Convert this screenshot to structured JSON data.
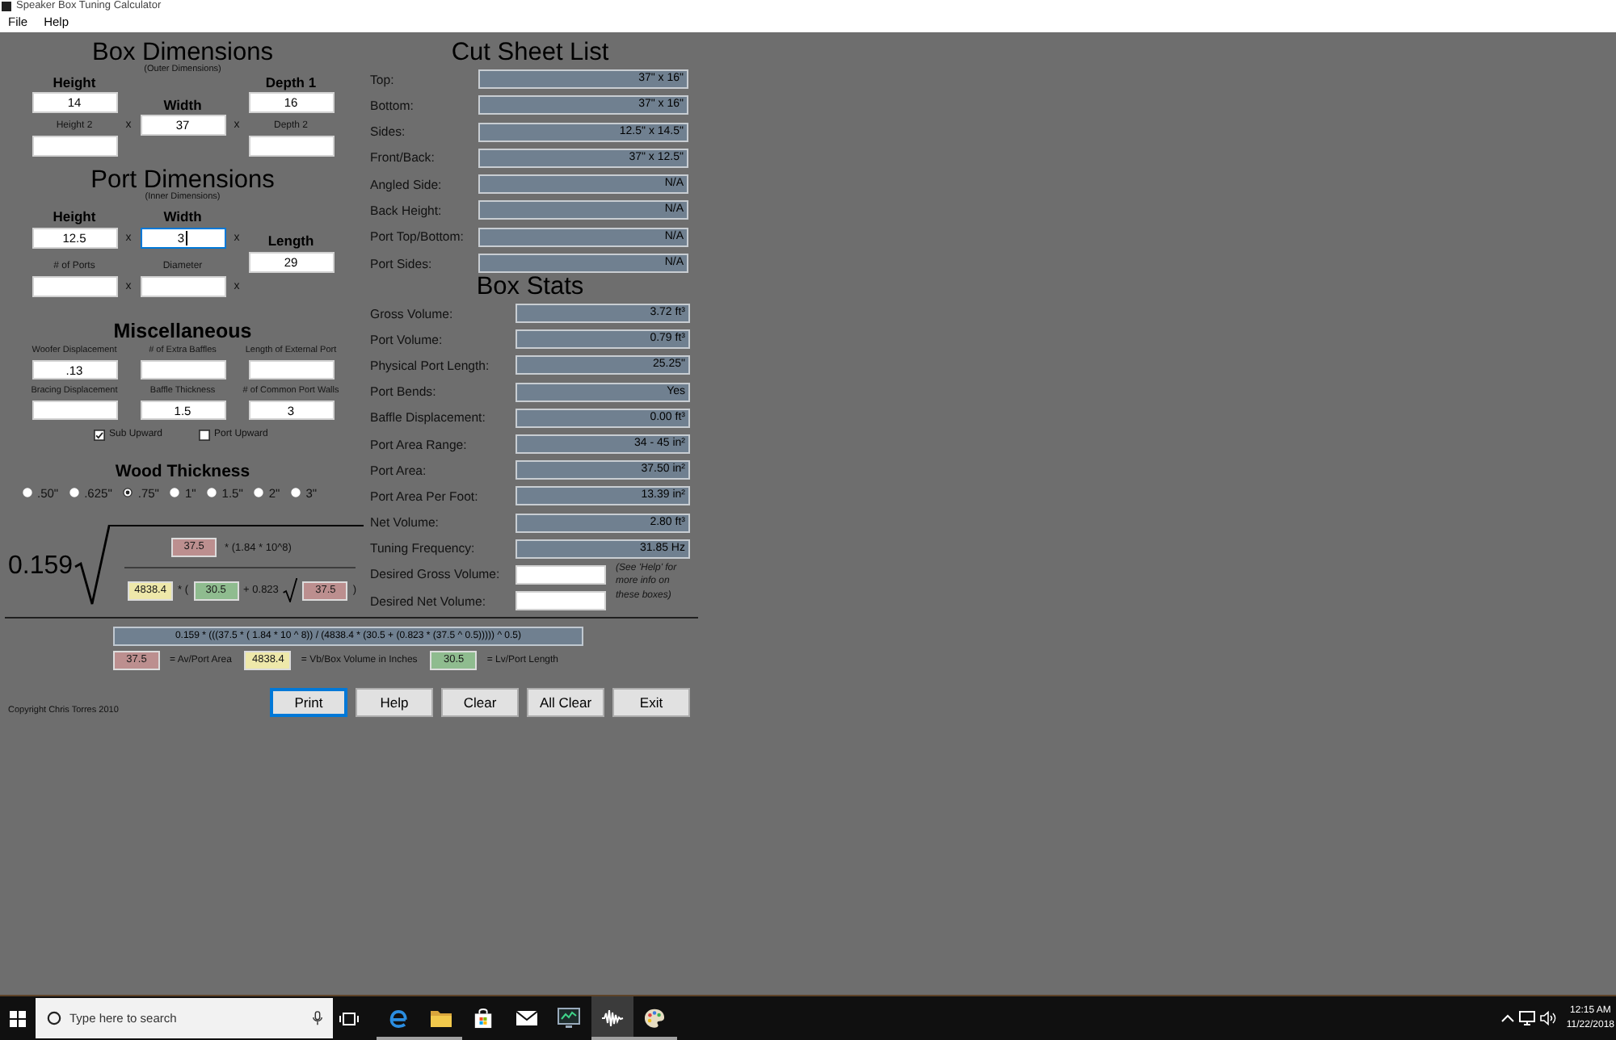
{
  "window": {
    "title": "Speaker Box Tuning Calculator"
  },
  "menu": [
    "File",
    "Help"
  ],
  "box_dimensions": {
    "title": "Box Dimensions",
    "subtitle": "(Outer Dimensions)",
    "columns": [
      {
        "fields": [
          {
            "label": "Height",
            "kind": "main",
            "value": "14",
            "focused": false
          },
          {
            "label": "Height 2",
            "kind": "minor",
            "focused": false
          }
        ]
      },
      {
        "fields": [
          {
            "label": "Width",
            "kind": "main",
            "value": "37",
            "focused": false
          }
        ]
      },
      {
        "fields": [
          {
            "label": "Depth 1",
            "kind": "main",
            "value": "16",
            "focused": false
          },
          {
            "label": "Depth 2",
            "kind": "minor",
            "focused": false
          }
        ]
      }
    ],
    "separators": [
      [
        "x"
      ],
      [
        "x"
      ]
    ]
  },
  "port_dimensions": {
    "title": "Port Dimensions",
    "subtitle": "(Inner Dimensions)",
    "columns": [
      {
        "fields": [
          {
            "label": "Height",
            "kind": "main",
            "value": "12.5",
            "focused": false
          },
          {
            "label": "# of Ports",
            "kind": "minor",
            "focused": false
          }
        ]
      },
      {
        "fields": [
          {
            "label": "Width",
            "kind": "main",
            "value": "3",
            "focused": true
          },
          {
            "label": "Diameter",
            "kind": "minor",
            "focused": false
          }
        ]
      },
      {
        "fields": [
          {
            "label": "Length",
            "kind": "main",
            "value": "29",
            "focused": false
          }
        ]
      }
    ],
    "separators": [
      [
        "x",
        "x"
      ],
      [
        "x",
        "x"
      ]
    ]
  },
  "miscellaneous": {
    "title": "Miscellaneous",
    "columns": [
      {
        "fields": [
          {
            "label": "Woofer Displacement",
            "kind": "minor",
            "value": ".13",
            "focused": false
          },
          {
            "label": "Bracing Displacement",
            "kind": "minor",
            "focused": false
          }
        ]
      },
      {
        "fields": [
          {
            "label": "# of Extra Baffles",
            "kind": "minor",
            "focused": false
          },
          {
            "label": "Baffle Thickness",
            "kind": "minor",
            "value": "1.5",
            "focused": false
          }
        ]
      },
      {
        "fields": [
          {
            "label": "Length of External Port",
            "kind": "minor",
            "focused": false
          },
          {
            "label": "# of Common Port Walls",
            "kind": "minor",
            "value": "3",
            "focused": false
          }
        ]
      }
    ],
    "checkboxes": [
      {
        "label": "Sub Upward",
        "checked": true
      },
      {
        "label": "Port Upward",
        "checked": false
      }
    ]
  },
  "wood_thickness": {
    "title": "Wood Thickness",
    "options": [
      {
        "label": ".50\"",
        "selected": false
      },
      {
        "label": ".625\"",
        "selected": false
      },
      {
        "label": ".75\"",
        "selected": true
      },
      {
        "label": "1\"",
        "selected": false
      },
      {
        "label": "1.5\"",
        "selected": false
      },
      {
        "label": "2\"",
        "selected": false
      },
      {
        "label": "3\"",
        "selected": false
      }
    ]
  },
  "formula": {
    "coefficient": "0.159",
    "numerator": [
      {
        "kind": "value",
        "value": "37.5",
        "color": "#bc8f8f"
      },
      {
        "kind": "text",
        "text": "* (1.84 * 10^8)"
      }
    ],
    "denominator": [
      {
        "kind": "value",
        "value": "4838.4",
        "color": "#eee8aa"
      },
      {
        "kind": "text",
        "text": "* ("
      },
      {
        "kind": "value",
        "value": "30.5",
        "color": "#8fbc8f"
      },
      {
        "kind": "text",
        "text": "+ 0.823"
      },
      {
        "kind": "root"
      },
      {
        "kind": "value",
        "value": "37.5",
        "color": "#bc8f8f"
      },
      {
        "kind": "text",
        "text": ")"
      }
    ]
  },
  "cut_sheet": {
    "title": "Cut Sheet List",
    "rows": [
      {
        "label": "Top:",
        "value": "37\" x 16\""
      },
      {
        "label": "Bottom:",
        "value": "37\" x 16\""
      },
      {
        "label": "Sides:",
        "value": "12.5\" x 14.5\""
      },
      {
        "label": "Front/Back:",
        "value": "37\" x 12.5\""
      },
      {
        "label": "Angled Side:",
        "value": "N/A"
      },
      {
        "label": "Back Height:",
        "value": "N/A"
      },
      {
        "label": "Port Top/Bottom:",
        "value": "N/A"
      },
      {
        "label": "Port Sides:",
        "value": "N/A"
      }
    ]
  },
  "box_stats": {
    "title": "Box Stats",
    "rows": [
      {
        "label": "Gross Volume:",
        "value": "3.72 ft³"
      },
      {
        "label": "Port Volume:",
        "value": "0.79 ft³"
      },
      {
        "label": "Physical Port Length:",
        "value": "25.25\""
      },
      {
        "label": "Port Bends:",
        "value": "Yes"
      },
      {
        "label": "Baffle Displacement:",
        "value": "0.00 ft³"
      },
      {
        "label": "Port Area Range:",
        "value": "34 - 45 in²"
      },
      {
        "label": "Port Area:",
        "value": "37.50 in²"
      },
      {
        "label": "Port Area Per Foot:",
        "value": "13.39 in²"
      },
      {
        "label": "Net Volume:",
        "value": "2.80 ft³"
      },
      {
        "label": "Tuning Frequency:",
        "value": "31.85 Hz"
      }
    ],
    "targets": [
      {
        "label": "Desired Gross Volume:"
      },
      {
        "label": "Desired Net Volume:"
      }
    ],
    "note": "(See 'Help' for more info on these boxes)"
  },
  "expression": "0.159 * (((37.5 * ( 1.84 * 10 ^ 8)) / (4838.4 * (30.5 + (0.823 * (37.5 ^ 0.5))))) ^ 0.5)",
  "legend": [
    {
      "value": "37.5",
      "color": "#bc8f8f",
      "label": "= Av/Port Area"
    },
    {
      "value": "4838.4",
      "color": "#eee8aa",
      "label": "= Vb/Box Volume in Inches"
    },
    {
      "value": "30.5",
      "color": "#8fbc8f",
      "label": "= Lv/Port Length"
    }
  ],
  "copyright": "Copyright Chris Torres 2010",
  "buttons": [
    {
      "label": "Print",
      "focused": true
    },
    {
      "label": "Help",
      "focused": false
    },
    {
      "label": "Clear",
      "focused": false
    },
    {
      "label": "All Clear",
      "focused": false
    },
    {
      "label": "Exit",
      "focused": false
    }
  ],
  "taskbar": {
    "search": {
      "placeholder": "Type here to search"
    },
    "apps": [
      {
        "kind": "edge",
        "running": true,
        "active": false
      },
      {
        "kind": "folder",
        "running": true,
        "active": false
      },
      {
        "kind": "store",
        "running": false,
        "active": false
      },
      {
        "kind": "mail",
        "running": false,
        "active": false
      },
      {
        "kind": "monitor",
        "running": false,
        "active": false
      },
      {
        "kind": "waveform",
        "running": true,
        "active": true
      },
      {
        "kind": "palette",
        "running": true,
        "active": false
      }
    ],
    "clock": {
      "time": "12:15 AM",
      "date": "11/22/2018"
    }
  }
}
